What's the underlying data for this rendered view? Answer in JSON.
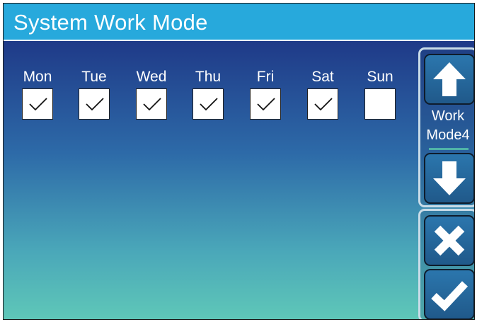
{
  "header": {
    "title": "System Work Mode"
  },
  "days": [
    {
      "label": "Mon",
      "checked": true
    },
    {
      "label": "Tue",
      "checked": true
    },
    {
      "label": "Wed",
      "checked": true
    },
    {
      "label": "Thu",
      "checked": true
    },
    {
      "label": "Fri",
      "checked": true
    },
    {
      "label": "Sat",
      "checked": true
    },
    {
      "label": "Sun",
      "checked": false
    }
  ],
  "mode_selector": {
    "line1": "Work",
    "line2": "Mode4"
  },
  "icons": {
    "up": "arrow-up-icon",
    "down": "arrow-down-icon",
    "cancel": "close-icon",
    "confirm": "checkmark-icon"
  },
  "colors": {
    "header_bg": "#27a9dc",
    "bg_top": "#1f3a88",
    "bg_bottom": "#5fc8b8"
  }
}
